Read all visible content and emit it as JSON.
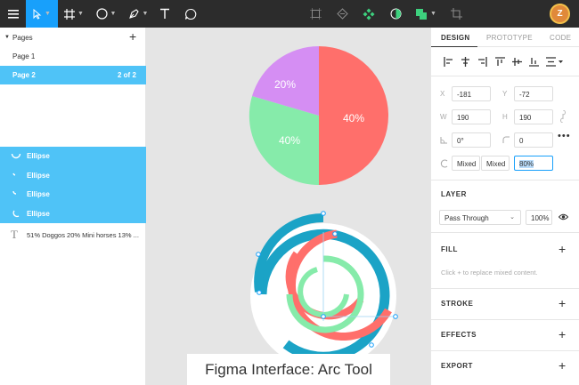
{
  "toolbar": {
    "menu_icon": "hamburger-icon",
    "tools": [
      "move-tool-icon",
      "frame-tool-icon",
      "ellipse-tool-icon",
      "pen-tool-icon",
      "text-tool-icon",
      "comment-tool-icon"
    ],
    "center_tools": [
      "flatten-icon",
      "component-icon",
      "create-component-icon",
      "boolean-mask-icon",
      "union-icon",
      "crop-icon"
    ],
    "avatar_initial": "Z",
    "accent": "#18a0fb"
  },
  "pages": {
    "header": "Pages",
    "items": [
      {
        "label": "Page 1",
        "count": ""
      },
      {
        "label": "Page 2",
        "count": "2 of 2"
      }
    ]
  },
  "layers": {
    "items": [
      "Ellipse",
      "Ellipse",
      "Ellipse",
      "Ellipse"
    ],
    "text_layer": "51% Doggos 20% Mini horses 13% ..."
  },
  "canvas": {
    "pie_labels": [
      "20%",
      "40%",
      "40%"
    ],
    "colors": {
      "purple": "#d58ef3",
      "green": "#86ebaa",
      "red": "#ff6f6b",
      "blue": "#1ba3c6"
    }
  },
  "caption": "Figma Interface: Arc Tool",
  "design_panel": {
    "tabs": [
      "DESIGN",
      "PROTOTYPE",
      "CODE"
    ],
    "x_label": "X",
    "x_value": "-181",
    "y_label": "Y",
    "y_value": "-72",
    "w_label": "W",
    "w_value": "190",
    "h_label": "H",
    "h_value": "190",
    "rotation_value": "0°",
    "radius_value": "0",
    "arc_start": "Mixed",
    "arc_sweep": "Mixed",
    "arc_ratio": "80%",
    "layer_title": "LAYER",
    "blend_mode": "Pass Through",
    "opacity": "100%",
    "fill_title": "FILL",
    "fill_hint": "Click + to replace mixed content.",
    "stroke_title": "STROKE",
    "effects_title": "EFFECTS",
    "export_title": "EXPORT"
  }
}
